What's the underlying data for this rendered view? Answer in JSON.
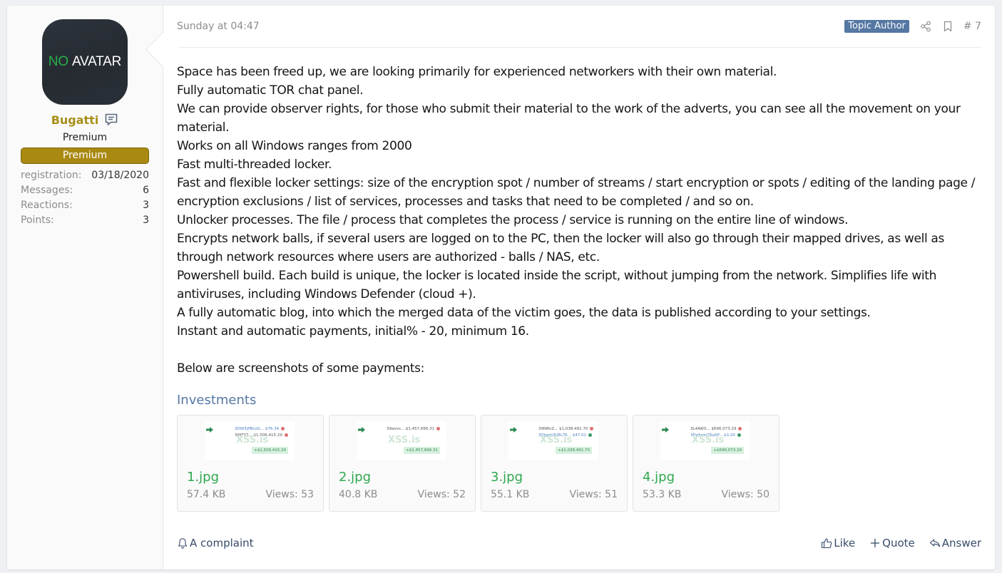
{
  "user": {
    "avatar_text_green": "NO",
    "avatar_text_white": "AVATAR",
    "name": "Bugatti",
    "title": "Premium",
    "banner": "Premium",
    "stats": [
      {
        "label": "registration:",
        "value": "03/18/2020"
      },
      {
        "label": "Messages:",
        "value": "6"
      },
      {
        "label": "Reactions:",
        "value": "3"
      },
      {
        "label": "Points:",
        "value": "3"
      }
    ]
  },
  "post": {
    "date": "Sunday at 04:47",
    "author_badge": "Topic Author",
    "number": "# 7",
    "paragraphs": [
      "Space has been freed up, we are looking primarily for experienced networkers with their own material.",
      "Fully automatic TOR chat panel.",
      "We can provide observer rights, for those who submit their material to the work of the adverts, you can see all the movement on your material.",
      "Works on all Windows ranges from 2000",
      "Fast multi-threaded locker.",
      "Fast and flexible locker settings: size of the encryption spot / number of streams / start encryption or spots / editing of the landing page / encryption exclusions / list of services, processes and tasks that need to be completed / and so on.",
      "Unlocker processes. The file / process that completes the process / service is running on the entire line of windows.",
      "Encrypts network balls, if several users are logged on to the PC, then the locker will also go through their mapped drives, as well as through network resources where users are authorized - balls / NAS, etc.",
      "Powershell build. Each build is unique, the locker is located inside the script, without jumping from the network. Simplifies life with antiviruses, including Windows Defender (cloud +).",
      "A fully automatic blog, into which the merged data of the victim goes, the data is published according to your settings.",
      "Instant and automatic payments, initial% - 20, minimum 16.",
      "",
      "Below are screenshots of some payments:"
    ]
  },
  "attachments": {
    "title": "Investments",
    "items": [
      {
        "name": "1.jpg",
        "size": "57.4 KB",
        "views": "Views: 53",
        "thumb": {
          "line1": "3DW3jPBnzG...  $76.34",
          "line2": "3JHTY7...  $1,506,415.29",
          "watermark": "XSS.is",
          "total": "+$1,506,415.29"
        }
      },
      {
        "name": "2.jpg",
        "size": "40.8 KB",
        "views": "Views: 52",
        "thumb": {
          "line1": "39aovs...  $1,457,666.31",
          "line2": "",
          "watermark": "XSS.is",
          "total": "+$1,457,666.31"
        }
      },
      {
        "name": "3.jpg",
        "size": "55.1 KB",
        "views": "Views: 51",
        "thumb": {
          "line1": "39NRnZ...  $1,038,491.70",
          "line2": "3DJgpb3V8L7K...  $47.01",
          "watermark": "XSS.is",
          "total": "+$1,038,491.70"
        }
      },
      {
        "name": "4.jpg",
        "size": "53.3 KB",
        "views": "Views: 50",
        "thumb": {
          "line1": "3L4AWS...  $696,073.29",
          "line2": "3Fw5mnZ6y6P...  $3.20",
          "watermark": "XSS.is",
          "total": "+$696,073.29"
        }
      }
    ]
  },
  "footer": {
    "complaint": "A complaint",
    "like": "Like",
    "quote": "Quote",
    "answer": "Answer"
  },
  "colors": {
    "username": "#a88f18",
    "banner": "#a98912",
    "author_badge": "#5577a3",
    "link_green": "#2fa84f",
    "attach_title": "#5577a3"
  }
}
